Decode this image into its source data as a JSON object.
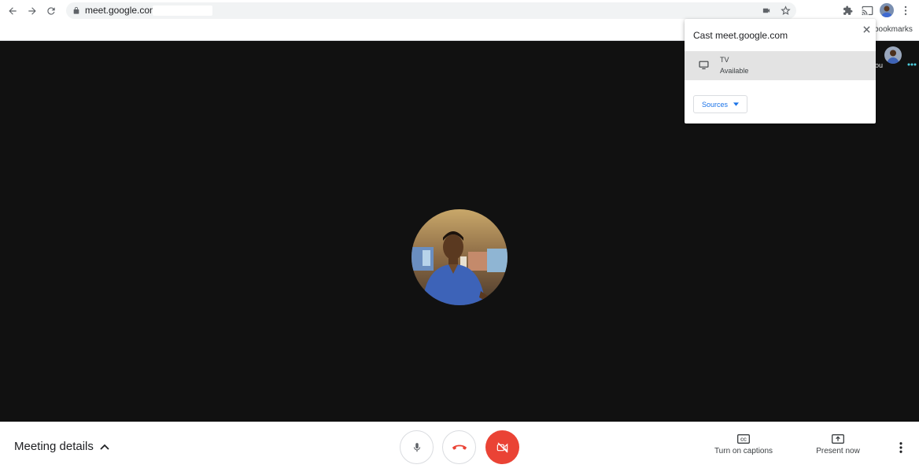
{
  "browser": {
    "url": "meet.google.com/",
    "bookmarks_label": "bookmarks"
  },
  "stage": {
    "self_label": "ou"
  },
  "controls": {
    "meeting_details_label": "Meeting details",
    "captions_label": "Turn on captions",
    "present_label": "Present now",
    "camera_status": "off",
    "colors": {
      "hangup": "#ea4335",
      "camera_off": "#ea4335"
    }
  },
  "cast_popup": {
    "title": "Cast meet.google.com",
    "sinks": [
      {
        "name": "TV",
        "status": "Available",
        "icon": "monitor-icon"
      }
    ],
    "sources_label": "Sources"
  }
}
